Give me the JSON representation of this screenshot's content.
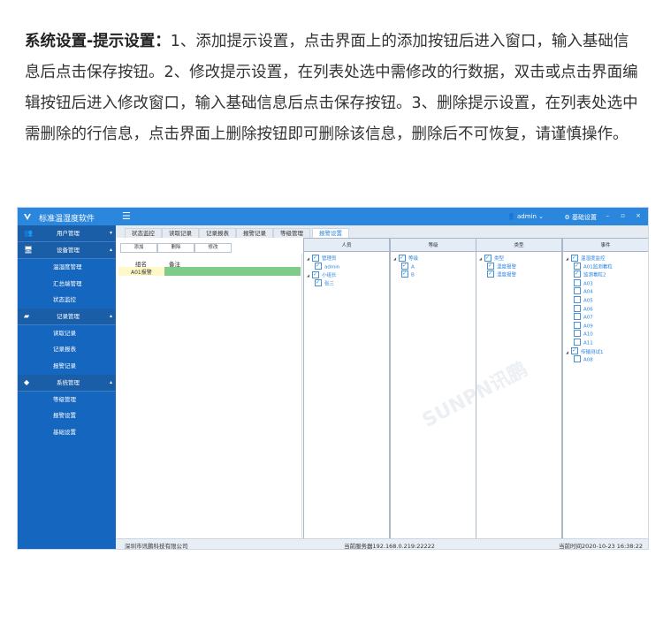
{
  "intro": {
    "title": "系统设置-提示设置：",
    "text": "1、添加提示设置，点击界面上的添加按钮后进入窗口，输入基础信息后点击保存按钮。2、修改提示设置，在列表处选中需修改的行数据，双击或点击界面编辑按钮后进入修改窗口，输入基础信息后点击保存按钮。3、删除提示设置，在列表处选中需删除的行信息，点击界面上删除按钮即可删除该信息，删除后不可恢复，请谨慎操作。"
  },
  "app": {
    "title": "标准温湿度软件",
    "menu_icon": "☰",
    "user": "admin",
    "basic_settings": "基础设置",
    "accent": "#2b86dd"
  },
  "sidebar": {
    "groups": [
      {
        "label": "用户管理",
        "icon": "users-icon",
        "items": []
      },
      {
        "label": "设备管理",
        "icon": "monitor-icon",
        "items": [
          "温湿度管理",
          "汇总端管理",
          "状态监控"
        ]
      },
      {
        "label": "记录管理",
        "icon": "folder-icon",
        "items": [
          "读取记录",
          "记录报表",
          "报警记录"
        ]
      },
      {
        "label": "系统管理",
        "icon": "cube-icon",
        "items": [
          "等级管理",
          "报警设置",
          "基础设置"
        ]
      }
    ]
  },
  "tabs": [
    "状态监控",
    "读取记录",
    "记录报表",
    "报警记录",
    "等级管理",
    "报警设置"
  ],
  "active_tab": "报警设置",
  "toolbar": {
    "add": "添加",
    "delete": "删除",
    "edit": "修改"
  },
  "grid": {
    "headers": [
      "组名",
      "备注"
    ],
    "rows": [
      {
        "name": "A01报警",
        "note": ""
      }
    ]
  },
  "panels": {
    "person": {
      "title": "人员",
      "root": "管理员",
      "items": [
        "admin"
      ],
      "root2": "小组长",
      "items2": [
        "张三"
      ]
    },
    "level": {
      "title": "等级",
      "root": "等级",
      "items": [
        "A",
        "B"
      ]
    },
    "type": {
      "title": "类型",
      "root": "类型",
      "items": [
        "温度报警",
        "湿度报警"
      ]
    },
    "device": {
      "title": "事件",
      "root": "温湿度监控",
      "items": [
        "A01监测着粒",
        "监测着粒2",
        "A03",
        "A04",
        "A05",
        "A06",
        "A07",
        "A09",
        "A10",
        "A11"
      ],
      "root2": "传输测试1",
      "items2": [
        "A08"
      ]
    }
  },
  "status": {
    "company": "深圳市讯鹏科技有限公司",
    "server": "当前服务器192.168.0.219:22222",
    "time": "当前时间2020-10-23 16:38:22"
  },
  "watermark": "SUNPN讯鹏"
}
